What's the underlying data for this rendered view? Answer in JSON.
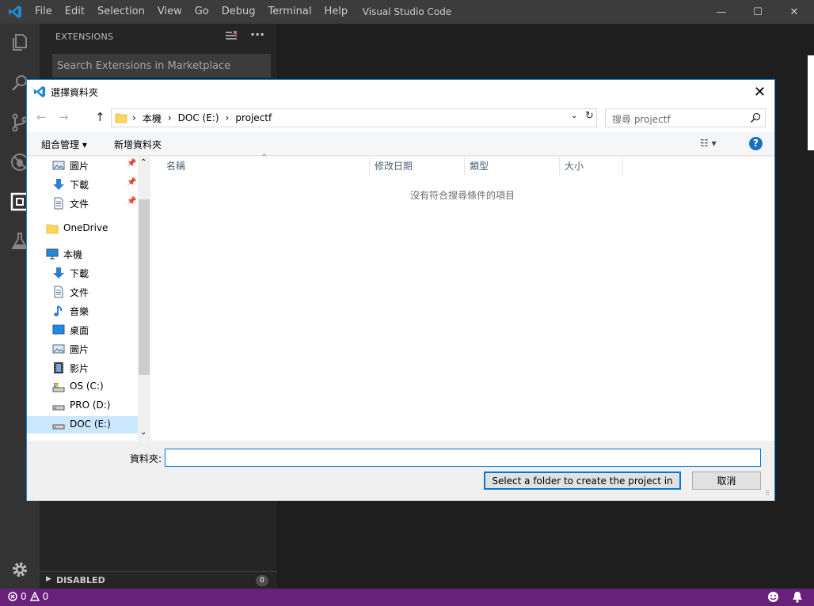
{
  "app": {
    "window_title": "Visual Studio Code",
    "menu": [
      "File",
      "Edit",
      "Selection",
      "View",
      "Go",
      "Debug",
      "Terminal",
      "Help"
    ],
    "window_controls": {
      "minimize": "—",
      "maximize": "☐",
      "close": "✕"
    }
  },
  "sidebar": {
    "title": "EXTENSIONS",
    "more": "···",
    "search_placeholder": "Search Extensions in Marketplace",
    "disabled_section": {
      "label": "DISABLED",
      "count": "0"
    }
  },
  "statusbar": {
    "errors": "0",
    "warnings": "0"
  },
  "dialog": {
    "title": "選擇資料夾",
    "close": "✕",
    "nav": {
      "back": "←",
      "forward": "→",
      "up": "↑"
    },
    "address": {
      "sep": "›",
      "crumbs": [
        "本機",
        "DOC (E:)",
        "projectf"
      ],
      "dropdown": "⌄",
      "refresh": "↻"
    },
    "search_placeholder": "搜尋 projectf",
    "commands": {
      "organize": "組合管理 ▾",
      "new_folder": "新增資料夾",
      "view": "☷ ▾",
      "help": "?"
    },
    "nav_pane": [
      {
        "label": "圖片",
        "icon": "pictures-icon",
        "pinned": true
      },
      {
        "label": "下載",
        "icon": "download-icon",
        "pinned": true
      },
      {
        "label": "文件",
        "icon": "documents-icon",
        "pinned": true
      },
      {
        "label": "OneDrive",
        "icon": "folder-icon",
        "pinned": false
      },
      {
        "label": "本機",
        "icon": "computer-icon",
        "pinned": false
      },
      {
        "label": "下載",
        "icon": "download-icon",
        "pinned": false
      },
      {
        "label": "文件",
        "icon": "documents-icon",
        "pinned": false
      },
      {
        "label": "音樂",
        "icon": "music-icon",
        "pinned": false
      },
      {
        "label": "桌面",
        "icon": "desktop-icon",
        "pinned": false
      },
      {
        "label": "圖片",
        "icon": "pictures-icon",
        "pinned": false
      },
      {
        "label": "影片",
        "icon": "videos-icon",
        "pinned": false
      },
      {
        "label": "OS (C:)",
        "icon": "system-drive-icon",
        "pinned": false
      },
      {
        "label": "PRO (D:)",
        "icon": "drive-icon",
        "pinned": false
      },
      {
        "label": "DOC (E:)",
        "icon": "drive-icon",
        "pinned": false,
        "selected": true
      }
    ],
    "pin": "📌",
    "columns": [
      "名稱",
      "修改日期",
      "類型",
      "大小"
    ],
    "sort_caret": "^",
    "scroll_up": "⌃",
    "scroll_down": "⌄",
    "empty_message": "沒有符合搜尋條件的項目",
    "folder_label": "資料夾:",
    "folder_value": "",
    "select_button": "Select a folder to create the project in",
    "cancel_button": "取消",
    "grip": "⠿"
  }
}
